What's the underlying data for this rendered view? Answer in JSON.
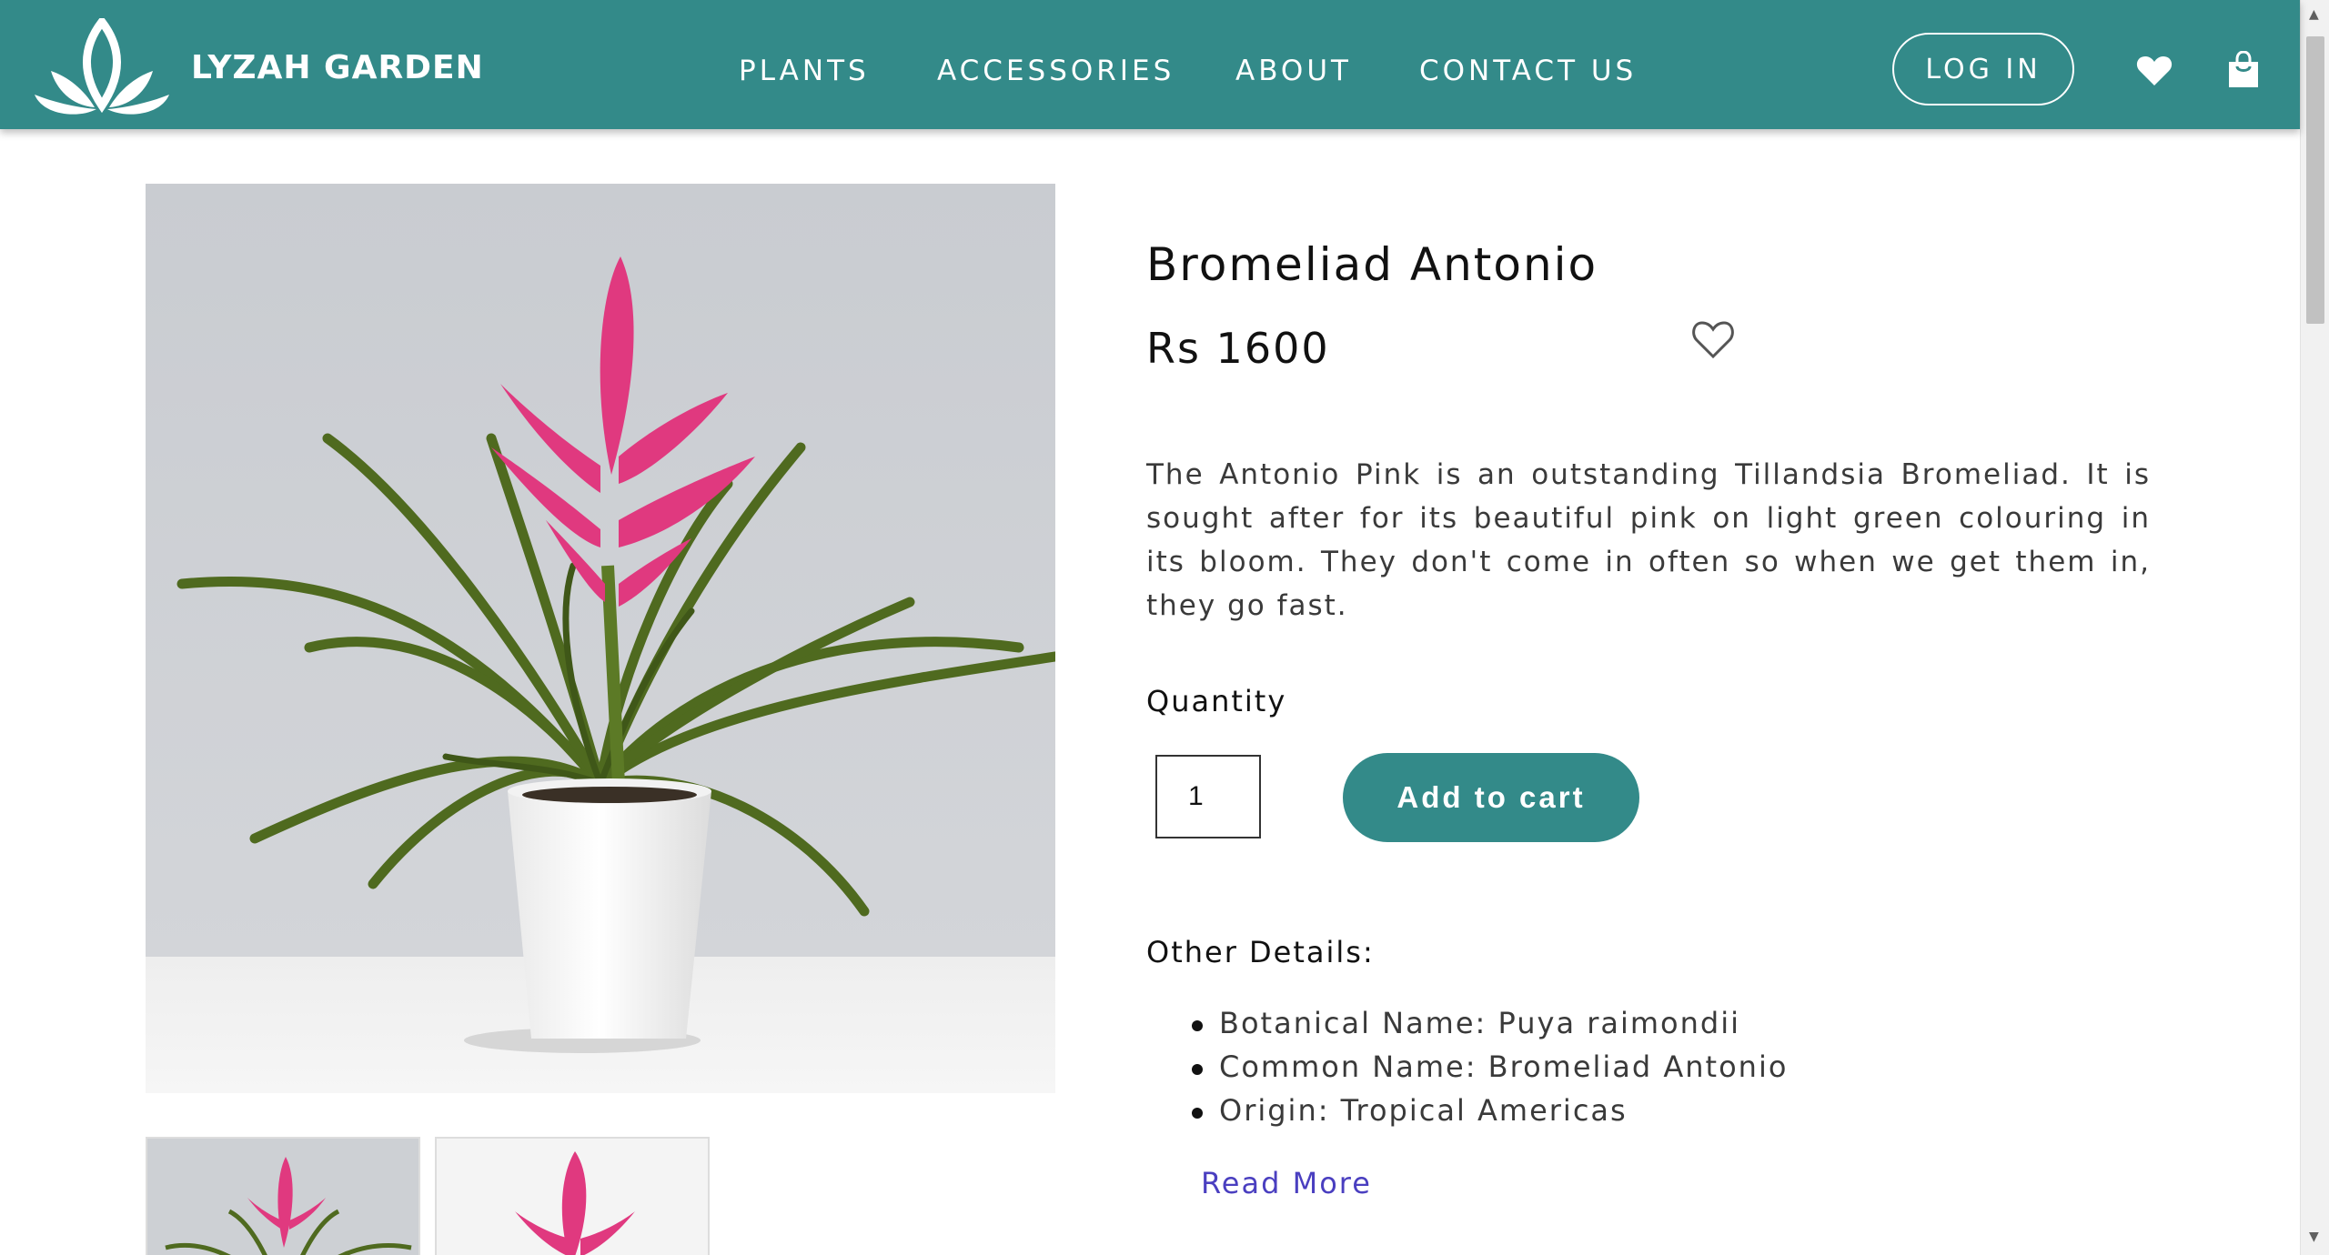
{
  "header": {
    "brand": "LYZAH GARDEN",
    "nav": [
      "PLANTS",
      "ACCESSORIES",
      "ABOUT",
      "CONTACT US"
    ],
    "login_label": "LOG IN",
    "icons": [
      "lotus-logo-icon",
      "heart-icon",
      "shopping-bag-icon"
    ]
  },
  "product": {
    "title": "Bromeliad Antonio",
    "price": "Rs 1600",
    "description": "The Antonio Pink is an outstanding Tillandsia Bromeliad. It is sought after for its beautiful pink on light green colouring in its bloom. They don't come in often so when we get them in, they go fast.",
    "quantity_label": "Quantity",
    "quantity_value": "1",
    "add_to_cart_label": "Add to cart",
    "other_details_heading": "Other Details:",
    "details": [
      "Botanical Name: Puya raimondii",
      "Common Name: Bromeliad Antonio",
      "Origin: Tropical Americas"
    ],
    "read_more_label": "Read More"
  },
  "colors": {
    "brand_teal": "#338a89",
    "link": "#4a3fc0",
    "bloom_pink": "#e0397f",
    "leaf_green": "#4f6a1f"
  }
}
